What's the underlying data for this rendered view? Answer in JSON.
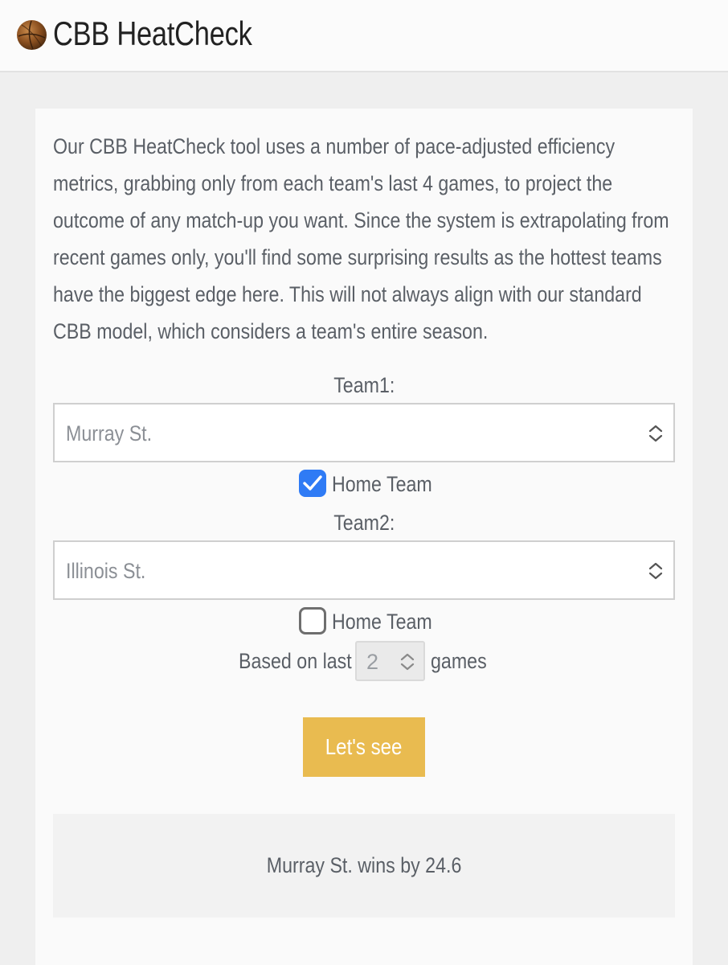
{
  "header": {
    "title": "CBB HeatCheck"
  },
  "intro_lines": [
    "Our CBB HeatCheck tool uses a number of pace-adjusted efficiency",
    "metrics, grabbing only from each team's last 4 games, to project the",
    "outcome of any match-up you want. Since the system is extrapolating from",
    "recent games only, you'll find some surprising results as the hottest teams",
    "have the biggest edge here. This will not always align with our standard",
    "CBB model, which considers a team's entire season."
  ],
  "team1": {
    "label": "Team1:",
    "selected": "Murray St.",
    "home_label": "Home Team",
    "home_checked": true
  },
  "team2": {
    "label": "Team2:",
    "selected": "Illinois St.",
    "home_label": "Home Team",
    "home_checked": false
  },
  "games": {
    "prefix": "Based on last",
    "selected": "2",
    "suffix": "games"
  },
  "submit_label": "Let's see",
  "result": "Murray St. wins by 24.6",
  "colors": {
    "accent_button": "#e9bb50",
    "checkbox_on": "#2f7bf5"
  }
}
